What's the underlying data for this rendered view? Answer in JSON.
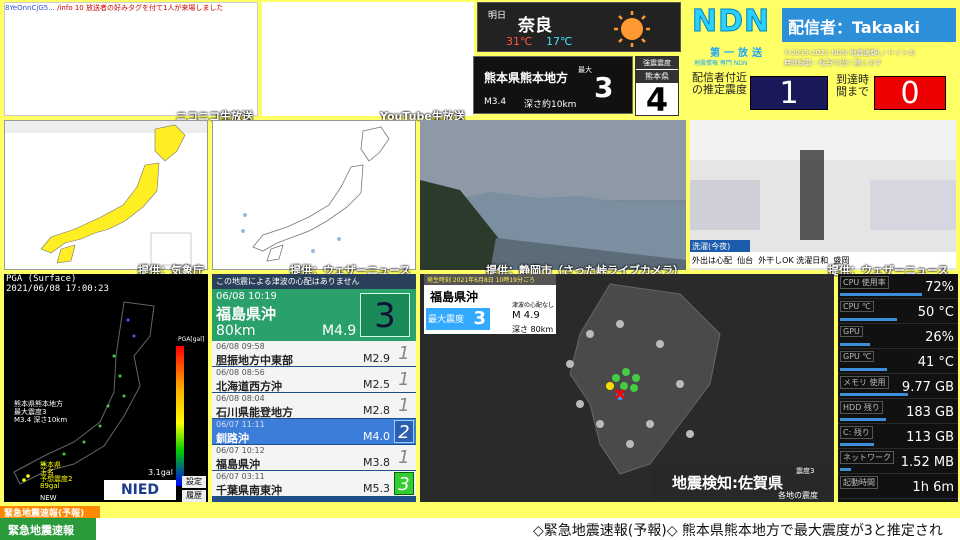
{
  "chat": {
    "user": "8YeOnnCjG5...",
    "message": "/info 10 放送者の好みタグを付て1人が来場しました"
  },
  "labels": {
    "niconico": "ニコニコ生放送",
    "youtube": "YouTube生放送",
    "src_map1": "提供：気象庁",
    "src_map2": "提供：ウェザーニュース",
    "src_cam1": "提供：静岡市（さった峠ライブカメラ）",
    "src_cam2": "提供：ウェザーニュース"
  },
  "weather": {
    "day": "明日",
    "city": "奈良",
    "high": "31℃",
    "low": "17℃",
    "icon": "sun-icon"
  },
  "quake_top": {
    "region": "熊本県熊本地方",
    "max_label": "最大",
    "intensity": "3",
    "magnitude": "M3.4",
    "depth": "深さ約10km"
  },
  "local": {
    "label1": "強震震度",
    "label2": "熊本県",
    "value": "4"
  },
  "ndn": {
    "logo": "NDN",
    "sub": "第一放送",
    "sub2": "地震情報 専門 NDN",
    "caster": "配信者：Takaaki",
    "copy1": "©2019-2021 NDN 地震速報(ノドイトの",
    "copy2": "無断転載・転写を固く禁じます",
    "est_label": "配信者付近の推定震度",
    "est_value": "1",
    "arr_label": "到達時間まで",
    "arr_value": "0"
  },
  "pga": {
    "title": "PGA (Surface)",
    "time": "2021/06/08 17:00:23",
    "note1": "熊本県熊本地方",
    "note2": "最大震度3",
    "note3": "M3.4 深さ10km",
    "site1": "熊本県",
    "site2": "玉名",
    "site3": "予想震度2",
    "site4": "89gal",
    "unit": "PGA[gal]",
    "maxgal": "3.1gal",
    "new": "NEW",
    "btn_settings": "設定",
    "btn_history": "履歴",
    "logo": "NIED"
  },
  "qlist": {
    "header": "この地震による津波の心配はありません",
    "top": {
      "dt": "06/08 10:19",
      "region": "福島県沖",
      "depth": "80km",
      "mag": "M4.9",
      "int": "3"
    },
    "rows": [
      {
        "dt": "06/08 09:58",
        "region": "胆振地方中東部",
        "mag": "M2.9",
        "int": "1"
      },
      {
        "dt": "06/08 08:56",
        "region": "北海道西方沖",
        "mag": "M2.5",
        "int": "1"
      },
      {
        "dt": "06/08 08:04",
        "region": "石川県能登地方",
        "mag": "M2.8",
        "int": "1"
      },
      {
        "dt": "06/07 11:11",
        "region": "釧路沖",
        "mag": "M4.0",
        "int": "2"
      },
      {
        "dt": "06/07 10:12",
        "region": "福島県沖",
        "mag": "M3.8",
        "int": "1"
      },
      {
        "dt": "06/07 03:11",
        "region": "千葉県南東沖",
        "mag": "M5.3",
        "int": "3"
      }
    ]
  },
  "eqmap": {
    "header": "発生時刻 2021年6月8日 10時19分ごろ",
    "region": "福島県沖",
    "max_label": "最大震度",
    "max_val": "3",
    "tsunami": "津波の心配なし",
    "mag": "M 4.9",
    "depth": "深さ 80km",
    "detect": "地震検知:佐賀県",
    "legend1": "震度3",
    "legend2": "各地の震度"
  },
  "perf": [
    {
      "k": "CPU 使用率",
      "v": "72%",
      "bar": 0.72
    },
    {
      "k": "CPU ℃",
      "v": "50 °C",
      "bar": 0.5
    },
    {
      "k": "GPU",
      "v": "26%",
      "bar": 0.26
    },
    {
      "k": "GPU ℃",
      "v": "41 °C",
      "bar": 0.41
    },
    {
      "k": "メモリ 使用",
      "v": "9.77 GB",
      "bar": 0.6
    },
    {
      "k": "HDD 残り",
      "v": "183 GB",
      "bar": 0.4
    },
    {
      "k": "C: 残り",
      "v": "113 GB",
      "bar": 0.3
    },
    {
      "k": "ネットワーク",
      "v": "1.52 MB",
      "bar": 0.1
    },
    {
      "k": "起動時間",
      "v": "1h 6m",
      "bar": 0
    }
  ],
  "bottom": {
    "tag": "緊急地震速報(予報)",
    "label": "緊急地震速報",
    "ticker": "◇緊急地震速報(予報)◇ 熊本県熊本地方で最大震度が3と推定され"
  },
  "cam2": {
    "caption": "洗濯(今夜)",
    "c1": "外出は心配",
    "c2": "仙台",
    "c3": "外干しOK 洗濯日和",
    "c4": "盛岡"
  }
}
